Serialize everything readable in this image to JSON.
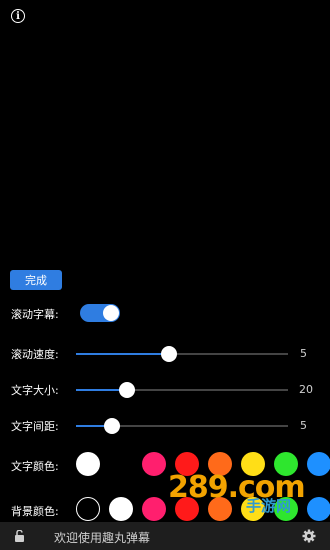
{
  "header": {
    "info_icon": "i"
  },
  "done_button": "完成",
  "rows": {
    "scroll": {
      "label": "滚动字幕:",
      "enabled": true
    },
    "speed": {
      "label": "滚动速度:",
      "value": "5",
      "level": 0.44
    },
    "size": {
      "label": "文字大小:",
      "value": "20",
      "level": 0.24
    },
    "spacing": {
      "label": "文字间距:",
      "value": "5",
      "level": 0.17
    },
    "text_color": {
      "label": "文字颜色:"
    },
    "bg_color": {
      "label": "背景颜色:"
    }
  },
  "text_colors": [
    "#ffffff",
    "#000000",
    "#ff1f6e",
    "#ff1a1a",
    "#ff6a1a",
    "#ffde17",
    "#2ee62e",
    "#1e90ff"
  ],
  "bg_colors": [
    "outline",
    "#ffffff",
    "#ff1f6e",
    "#ff1a1a",
    "#ff6a1a",
    "#ffde17",
    "#2ee62e",
    "#1e90ff"
  ],
  "bottom_bar": {
    "text": "欢迎使用趣丸弹幕"
  },
  "watermark": {
    "brand": "289.com",
    "sub": "手游网"
  },
  "colors": {
    "accent": "#2f7de1",
    "brand_orange": "#f2a300",
    "brand_blue": "#2f9ad0"
  }
}
